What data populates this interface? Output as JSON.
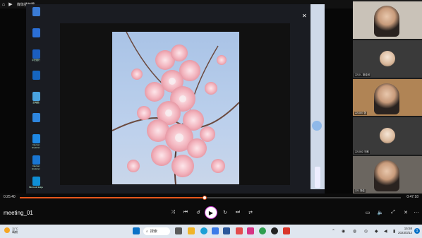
{
  "window": {
    "title": "媒体播放器"
  },
  "remote_desktop": {
    "desktop_icons": [
      {
        "label": "",
        "color": "#3a7bd5"
      },
      {
        "label": "",
        "color": "#2b6fd6"
      },
      {
        "label": "平安银行",
        "color": "#1b5ebf"
      },
      {
        "label": "",
        "color": "#1565c0"
      },
      {
        "label": "此电脑",
        "color": "#4aa3df"
      },
      {
        "label": "",
        "color": "#2e86de"
      },
      {
        "label": "Internet Explorer",
        "color": "#1e88e5"
      },
      {
        "label": "Internet Explorer",
        "color": "#1976d2"
      },
      {
        "label": "Microsoft Edge",
        "color": "#0f8fd6"
      }
    ]
  },
  "participants": [
    {
      "name": "",
      "kind": "video"
    },
    {
      "name": "2210 - 姚佳欣",
      "kind": "avatar"
    },
    {
      "name": "221007 张",
      "kind": "video"
    },
    {
      "name": "221002 王雅",
      "kind": "avatar"
    },
    {
      "name": "221 刘佳",
      "kind": "video"
    }
  ],
  "player": {
    "current_time": "0:25:40",
    "total_time": "0:47:18",
    "progress_fraction": 0.485,
    "file_name": "meeting_01",
    "accent": "#e8571c"
  },
  "taskbar": {
    "weather_temp": "11°C",
    "weather_desc": "晴朗",
    "search_label": "搜索",
    "time": "15:58",
    "date": "2023/3/12",
    "notification_count": "1",
    "search_placeholder": "搜索"
  }
}
